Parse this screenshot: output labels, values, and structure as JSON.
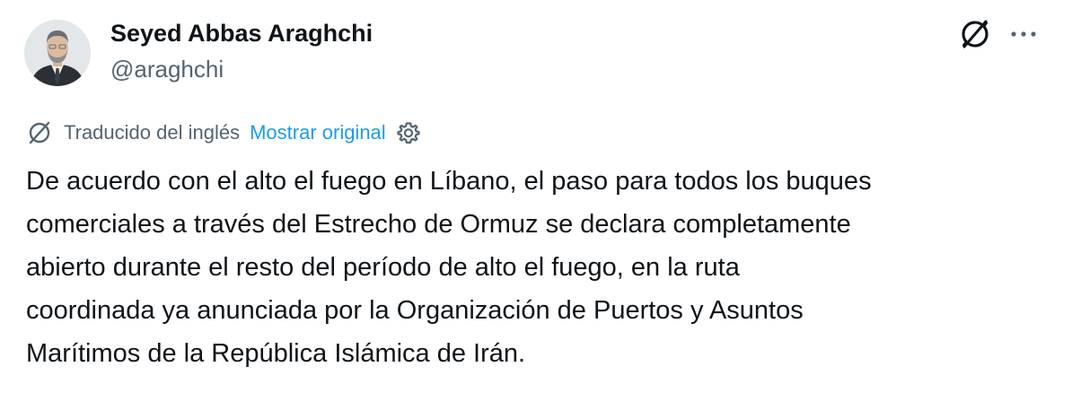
{
  "author": {
    "name": "Seyed Abbas Araghchi",
    "handle": "@araghchi"
  },
  "translation": {
    "label": "Traducido del inglés",
    "show_original": "Mostrar original"
  },
  "tweet": {
    "text": "De acuerdo con el alto el fuego en Líbano, el paso para todos los buques\ncomerciales a través del Estrecho de Ormuz se declara completamente\nabierto durante el resto del período de alto el fuego, en la ruta\ncoordinada ya anunciada por la Organización de Puertos y Asuntos\nMarítimos de la República Islámica de Irán."
  },
  "icons": {
    "translate": "translate-icon",
    "more": "more-options-icon",
    "settings": "gear-icon",
    "avatar": "profile-photo"
  },
  "colors": {
    "text": "#0f1419",
    "secondary": "#536471",
    "link": "#1d9bf0"
  }
}
